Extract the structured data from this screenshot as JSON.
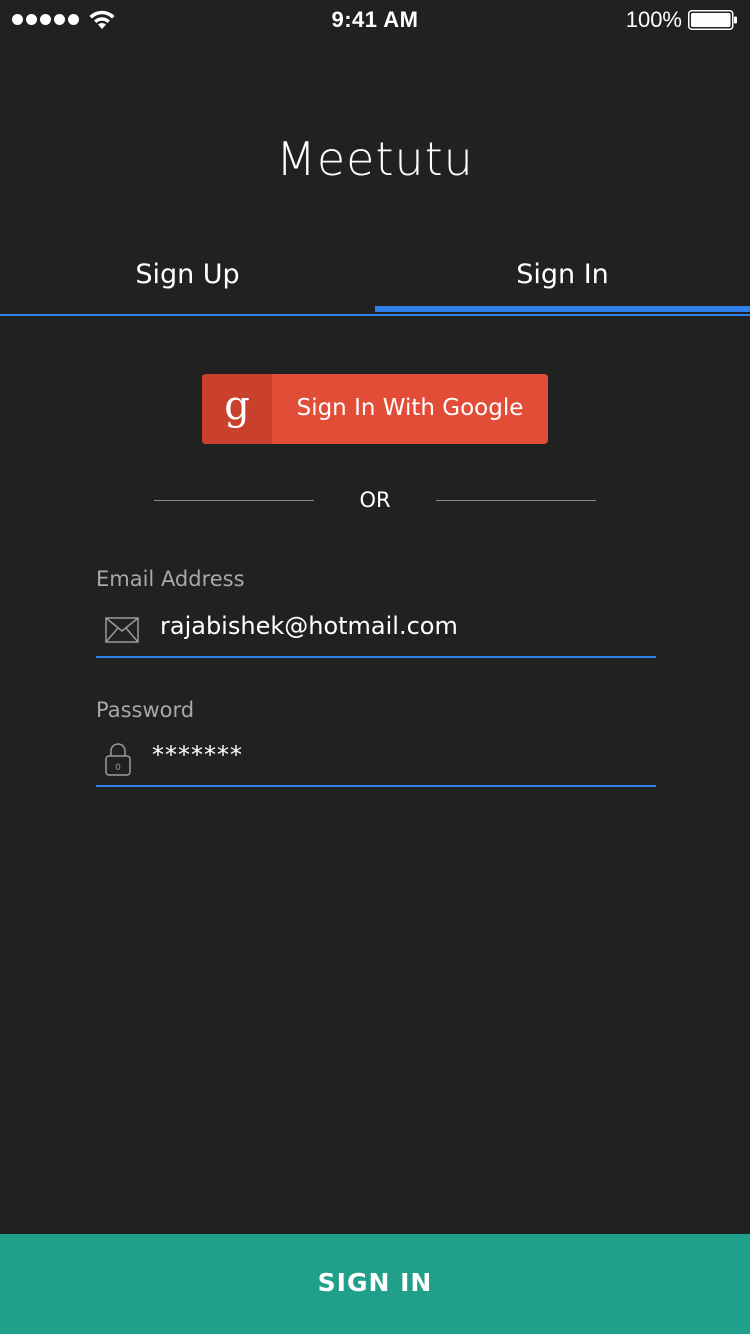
{
  "status_bar": {
    "time": "9:41 AM",
    "battery_percent": "100%",
    "signal_icon": "signal-dots-icon",
    "wifi_icon": "wifi-icon",
    "battery_icon": "battery-icon"
  },
  "app": {
    "title": "Meetutu"
  },
  "tabs": [
    {
      "label": "Sign Up",
      "active": false
    },
    {
      "label": "Sign In",
      "active": true
    }
  ],
  "google_button": {
    "icon": "google-g-icon",
    "icon_glyph": "g",
    "label": "Sign In With Google"
  },
  "divider": {
    "label": "OR"
  },
  "form": {
    "email": {
      "label": "Email Address",
      "icon": "envelope-icon",
      "value": "rajabishek@hotmail.com"
    },
    "password": {
      "label": "Password",
      "icon": "lock-icon",
      "value": "*******"
    }
  },
  "submit": {
    "label": "SIGN IN"
  },
  "colors": {
    "background": "#212121",
    "accent_blue": "#2f80ed",
    "google_red": "#e14d36",
    "google_red_dark": "#c9402c",
    "submit_teal": "#20a08a",
    "label_gray": "#a8a8a8"
  }
}
